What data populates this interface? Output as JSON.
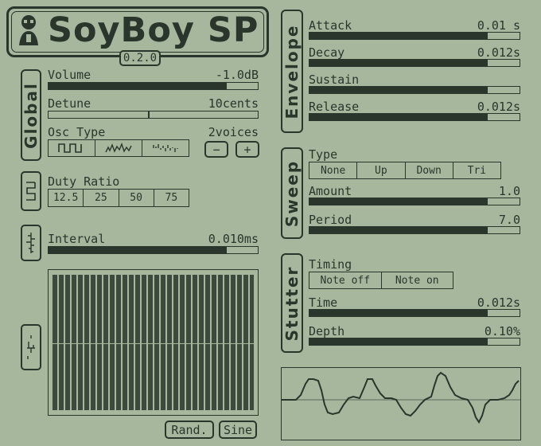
{
  "header": {
    "title": "SoyBoy SP",
    "version": "0.2.0"
  },
  "global": {
    "tab_label": "Global",
    "volume": {
      "label": "Volume",
      "value": "-1.0dB",
      "level": 0.85
    },
    "detune": {
      "label": "Detune",
      "value": "10cents",
      "level": 0.5
    },
    "osc_type": {
      "label": "Osc Type",
      "options": [
        "square-wave-icon",
        "triangle-wave-icon",
        "noise-wave-icon"
      ]
    },
    "voices": {
      "value": "2voices",
      "minus": "−",
      "plus": "+"
    }
  },
  "square": {
    "tab_icon": "square-wave-icon",
    "duty_ratio": {
      "label": "Duty Ratio",
      "options": [
        "12.5",
        "25",
        "50",
        "75"
      ]
    }
  },
  "noise": {
    "tab_icon": "noise-wave-icon",
    "interval": {
      "label": "Interval",
      "value": "0.010ms",
      "level": 0.85
    }
  },
  "wavetable": {
    "tab_icon": "wavetable-icon",
    "random_button": "Rand.",
    "sine_button": "Sine"
  },
  "envelope": {
    "tab_label": "Envelope",
    "attack": {
      "label": "Attack",
      "value": "0.01 s",
      "level": 0.85
    },
    "decay": {
      "label": "Decay",
      "value": "0.012s",
      "level": 0.85
    },
    "sustain": {
      "label": "Sustain",
      "value": "",
      "level": 0.85
    },
    "release": {
      "label": "Release",
      "value": "0.012s",
      "level": 0.85
    }
  },
  "sweep": {
    "tab_label": "Sweep",
    "type": {
      "label": "Type",
      "options": [
        "None",
        "Up",
        "Down",
        "Tri"
      ]
    },
    "amount": {
      "label": "Amount",
      "value": "1.0",
      "level": 0.85
    },
    "period": {
      "label": "Period",
      "value": "7.0",
      "level": 0.85
    }
  },
  "stutter": {
    "tab_label": "Stutter",
    "timing": {
      "label": "Timing",
      "options": [
        "Note off",
        "Note on"
      ]
    },
    "time": {
      "label": "Time",
      "value": "0.012s",
      "level": 0.85
    },
    "depth": {
      "label": "Depth",
      "value": "0.10%",
      "level": 0.85
    }
  },
  "colors": {
    "background": "#a7b79e",
    "ink": "#2a352c"
  }
}
